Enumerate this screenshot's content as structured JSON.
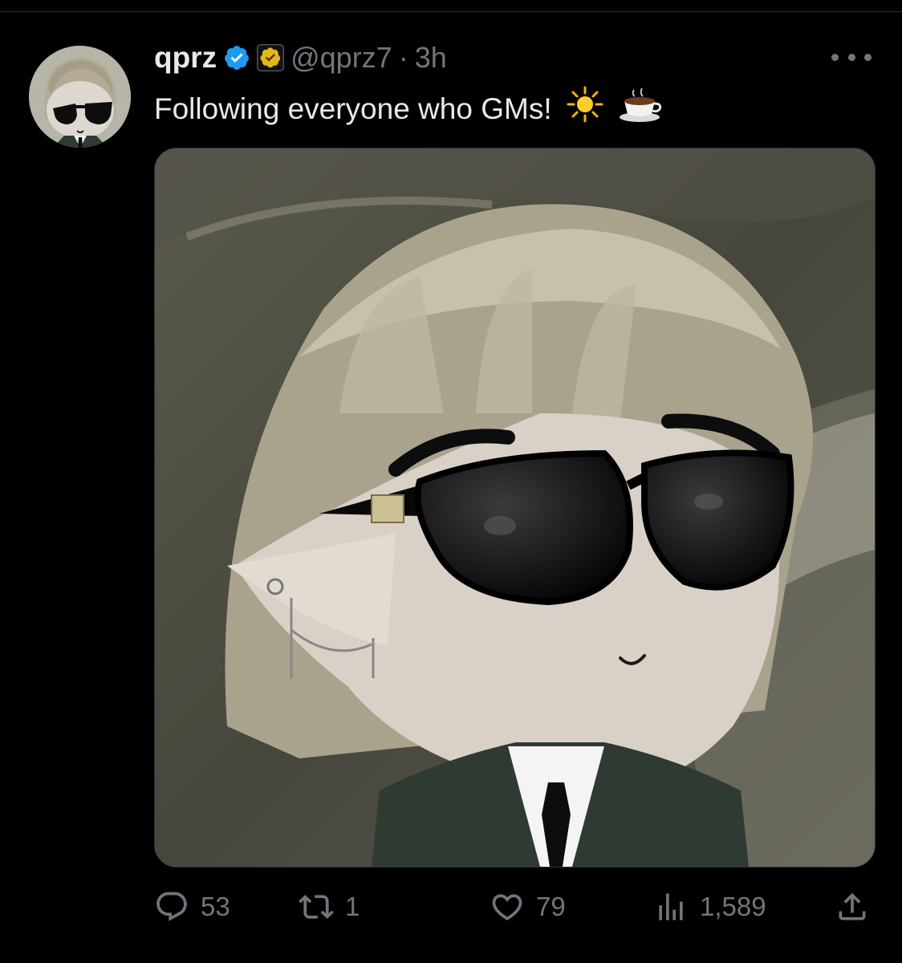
{
  "author": {
    "display_name": "qprz",
    "handle": "@qprz7",
    "separator": "·",
    "time": "3h",
    "verified_badge_icon": "verified-check-icon",
    "affiliate_badge_icon": "gold-check-badge-icon"
  },
  "tweet": {
    "text": "Following everyone who GMs!",
    "emojis": [
      "sun-emoji",
      "coffee-emoji"
    ]
  },
  "actions": {
    "reply_count": "53",
    "retweet_count": "1",
    "like_count": "79",
    "views_count": "1,589"
  },
  "colors": {
    "background": "#000000",
    "text_primary": "#e7e9ea",
    "text_secondary": "#71767b",
    "verified_blue": "#1d9bf0",
    "gold_badge": "#e2b719"
  }
}
